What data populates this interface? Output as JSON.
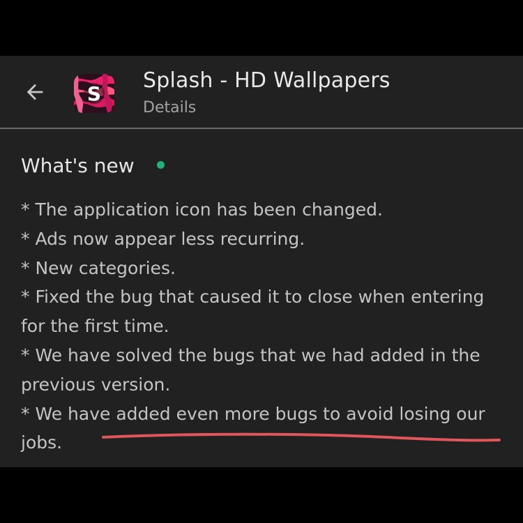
{
  "header": {
    "back_icon": "arrow-left-icon",
    "app_icon": "splash-app-logo",
    "app_icon_letter": "S",
    "title": "Splash - HD Wallpapers",
    "subtitle": "Details"
  },
  "whats_new": {
    "title": "What's new",
    "indicator_color": "#1fb37a",
    "lines": [
      "* The application icon has been changed.",
      "* Ads now appear less recurring.",
      "* New categories.",
      "* Fixed the bug that caused it to close when entering",
      "for the first time.",
      "* We have solved the bugs that we had added in the",
      "previous version.",
      "* We have added even more bugs to avoid losing our",
      "jobs."
    ]
  },
  "colors": {
    "background": "#212121",
    "underline": "#e0565b"
  }
}
